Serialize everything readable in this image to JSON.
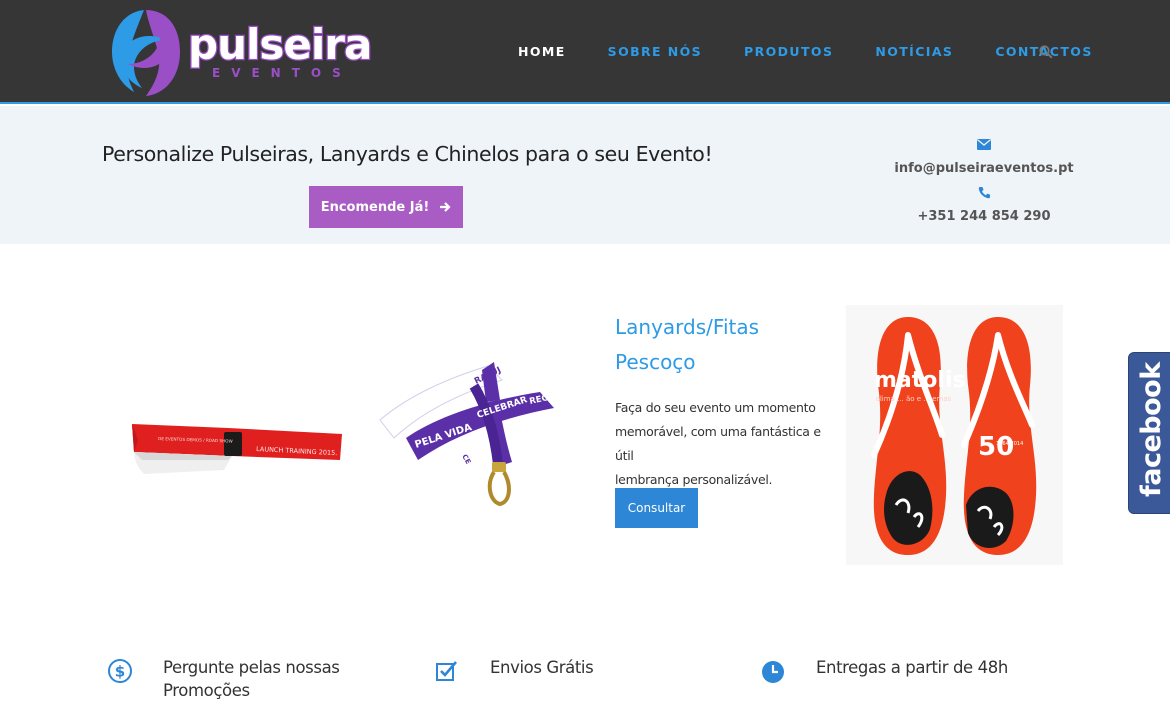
{
  "brand": {
    "name": "pulseira",
    "tagline": "EVENTOS",
    "colors": {
      "purple": "#9b4fc7",
      "blue": "#2d9be6"
    }
  },
  "nav": {
    "items": [
      "HOME",
      "SOBRE NÓS",
      "PRODUTOS",
      "NOTÍCIAS",
      "CONTACTOS"
    ],
    "active": "HOME",
    "search_icon": "search-icon"
  },
  "banner": {
    "title": "Personalize Pulseiras, Lanyards e Chinelos para o seu Evento!",
    "cta": "Encomende Já!",
    "email": "info@pulseiraeventos.pt",
    "phone": "+351 244 854 290"
  },
  "product": {
    "title_line1": "Lanyards/Fitas",
    "title_line2": "Pescoço",
    "description_line1": "Faça do seu evento um momento",
    "description_line2": "memorável, com uma fantástica e útil",
    "description_line3": "lembrança personalizável.",
    "button": "Consultar",
    "bracelet_print_line1": "DE EVENTOS DEMOS / ROAD SHOW",
    "bracelet_print_line2": "LAUNCH TRAINING 2015.",
    "lanyard_print": [
      "PELA VIDA",
      "CELEBRAR",
      "RATUJ",
      "REC",
      "CE"
    ],
    "flipflop_brand": "matolis",
    "flipflop_slogan": "clima ... ão e ... emas",
    "flipflop_badge": "50",
    "flipflop_years": "1964-2014"
  },
  "social": {
    "facebook_label": "facebook"
  },
  "features": [
    {
      "icon": "dollar-circle-icon",
      "line1": "Pergunte pelas nossas",
      "line2": "Promoções"
    },
    {
      "icon": "checkbox-icon",
      "line1": "Envios Grátis",
      "line2": ""
    },
    {
      "icon": "clock-icon",
      "line1": "Entregas a partir de 48h",
      "line2": ""
    }
  ]
}
